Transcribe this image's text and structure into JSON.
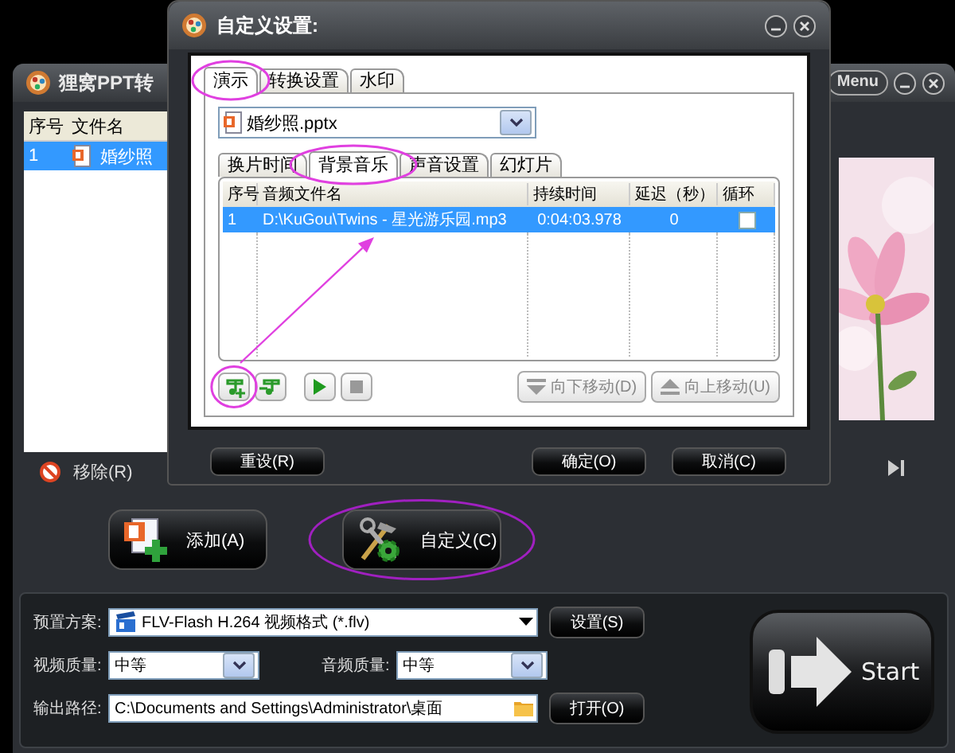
{
  "main_window": {
    "title": "狸窝PPT转",
    "menu_button": "Menu",
    "file_list": {
      "columns": [
        "序号",
        "文件名"
      ],
      "rows": [
        {
          "index": "1",
          "name": "婚纱照",
          "selected": true
        }
      ]
    },
    "remove_button": "移除(R)",
    "add_button": "添加(A)",
    "custom_button": "自定义(C)",
    "preset": {
      "label": "预置方案:",
      "value": "FLV-Flash H.264 视频格式 (*.flv)"
    },
    "settings_button": "设置(S)",
    "video_quality": {
      "label": "视频质量:",
      "value": "中等"
    },
    "audio_quality": {
      "label": "音频质量:",
      "value": "中等"
    },
    "output": {
      "label": "输出路径:",
      "value": "C:\\Documents and Settings\\Administrator\\桌面"
    },
    "open_button": "打开(O)",
    "start_button": "Start"
  },
  "dialog": {
    "title": "自定义设置:",
    "tabs": [
      {
        "label": "演示",
        "selected": true
      },
      {
        "label": "转换设置",
        "selected": false
      },
      {
        "label": "水印",
        "selected": false
      }
    ],
    "file_select": "婚纱照.pptx",
    "subtabs": [
      {
        "label": "换片时间",
        "selected": false
      },
      {
        "label": "背景音乐",
        "selected": true
      },
      {
        "label": "声音设置",
        "selected": false
      },
      {
        "label": "幻灯片",
        "selected": false
      }
    ],
    "table": {
      "columns": [
        "序号",
        "音频文件名",
        "持续时间",
        "延迟（秒）",
        "循环"
      ],
      "rows": [
        {
          "index": "1",
          "file": "D:\\KuGou\\Twins - 星光游乐园.mp3",
          "duration": "0:04:03.978",
          "delay": "0",
          "loop": false,
          "selected": true
        }
      ]
    },
    "move_down_button": "向下移动(D)",
    "move_up_button": "向上移动(U)",
    "buttons": [
      "重设(R)",
      "确定(O)",
      "取消(C)"
    ]
  }
}
